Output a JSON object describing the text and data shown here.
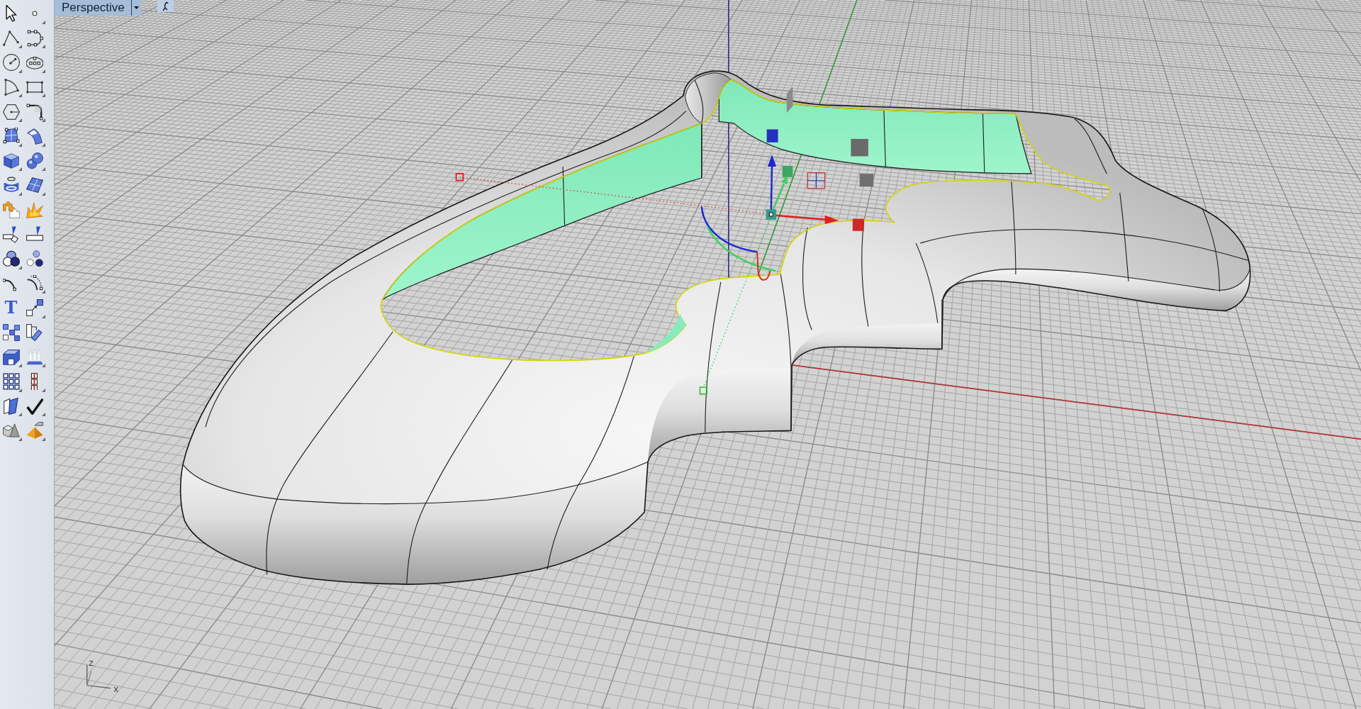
{
  "toolbar": {
    "tools": [
      {
        "flyout": false
      },
      {
        "flyout": true
      },
      {
        "flyout": true
      },
      {
        "flyout": true
      },
      {
        "flyout": true
      },
      {
        "flyout": true
      },
      {
        "flyout": true
      },
      {
        "flyout": true
      },
      {
        "flyout": true
      },
      {
        "flyout": true
      },
      {
        "flyout": true
      },
      {
        "flyout": true
      },
      {
        "flyout": true
      },
      {
        "flyout": true
      },
      {
        "flyout": true
      },
      {
        "flyout": true
      },
      {
        "flyout": false
      },
      {
        "flyout": false
      },
      {
        "flyout": false
      },
      {
        "flyout": false
      },
      {
        "flyout": true
      },
      {
        "flyout": false
      },
      {
        "flyout": false
      },
      {
        "flyout": true
      },
      {
        "flyout": false,
        "glyph": "T"
      },
      {
        "flyout": true
      },
      {
        "flyout": false
      },
      {
        "flyout": false
      },
      {
        "flyout": true
      },
      {
        "flyout": true
      },
      {
        "flyout": true
      },
      {
        "flyout": true
      },
      {
        "flyout": true
      },
      {
        "flyout": true
      },
      {
        "flyout": true
      },
      {
        "flyout": true
      }
    ]
  },
  "viewport": {
    "title": "Perspective",
    "axis_indicator": {
      "vertical_label": "z",
      "horizontal_label": "x"
    }
  }
}
